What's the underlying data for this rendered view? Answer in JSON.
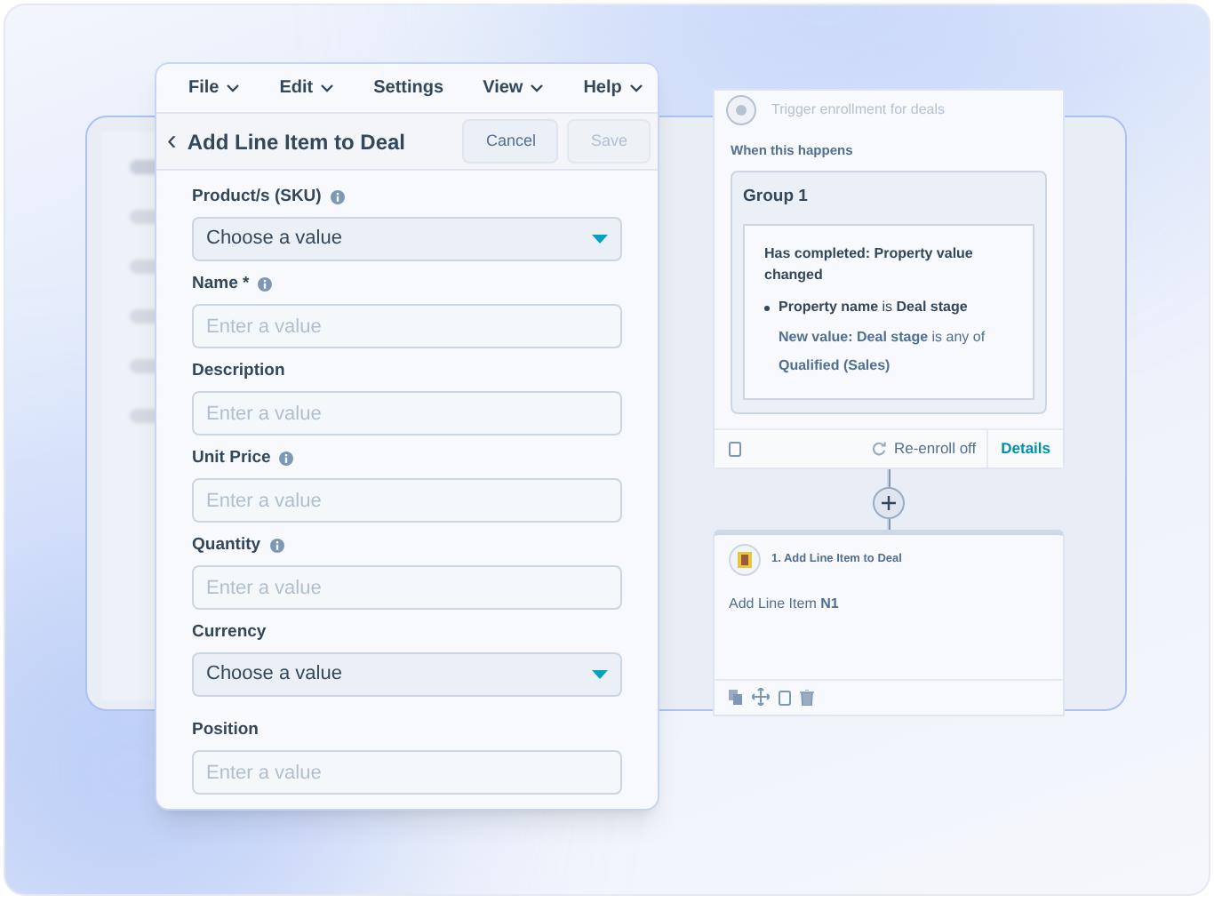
{
  "menu": [
    {
      "label": "File",
      "caret": true
    },
    {
      "label": "Edit",
      "caret": true
    },
    {
      "label": "Settings",
      "caret": false
    },
    {
      "label": "View",
      "caret": true
    },
    {
      "label": "Help",
      "caret": true
    }
  ],
  "form": {
    "back": "‹",
    "title": "Add Line Item to Deal",
    "cancel": "Cancel",
    "save": "Save",
    "save_disabled": true,
    "fields": [
      {
        "label": "Product/s (SKU)",
        "info": true,
        "kind": "select",
        "placeholder": "Choose a value"
      },
      {
        "label": "Name *",
        "info": true,
        "kind": "text",
        "placeholder": "Enter a value"
      },
      {
        "label": "Description",
        "info": false,
        "kind": "text",
        "placeholder": "Enter a value"
      },
      {
        "label": "Unit Price",
        "info": true,
        "kind": "text",
        "placeholder": "Enter a value"
      },
      {
        "label": "Quantity",
        "info": true,
        "kind": "text",
        "placeholder": "Enter a value"
      },
      {
        "label": "Currency",
        "info": false,
        "kind": "select",
        "placeholder": "Choose a value"
      },
      {
        "label": "Position",
        "info": false,
        "kind": "text",
        "placeholder": "Enter a value"
      }
    ]
  },
  "trigger": {
    "title": "Trigger enrollment for deals",
    "when": "When this happens",
    "group": "Group 1",
    "condition": "Has completed: Property value changed",
    "bullet": "**Property name** is **Deal stage**",
    "detail": "**New value: Deal stage** is any of **Qualified (Sales)**",
    "reenroll": "Re-enroll off",
    "details": "Details"
  },
  "action": {
    "title": "1. Add Line Item to Deal",
    "body": "Add Line Item **N1**"
  }
}
